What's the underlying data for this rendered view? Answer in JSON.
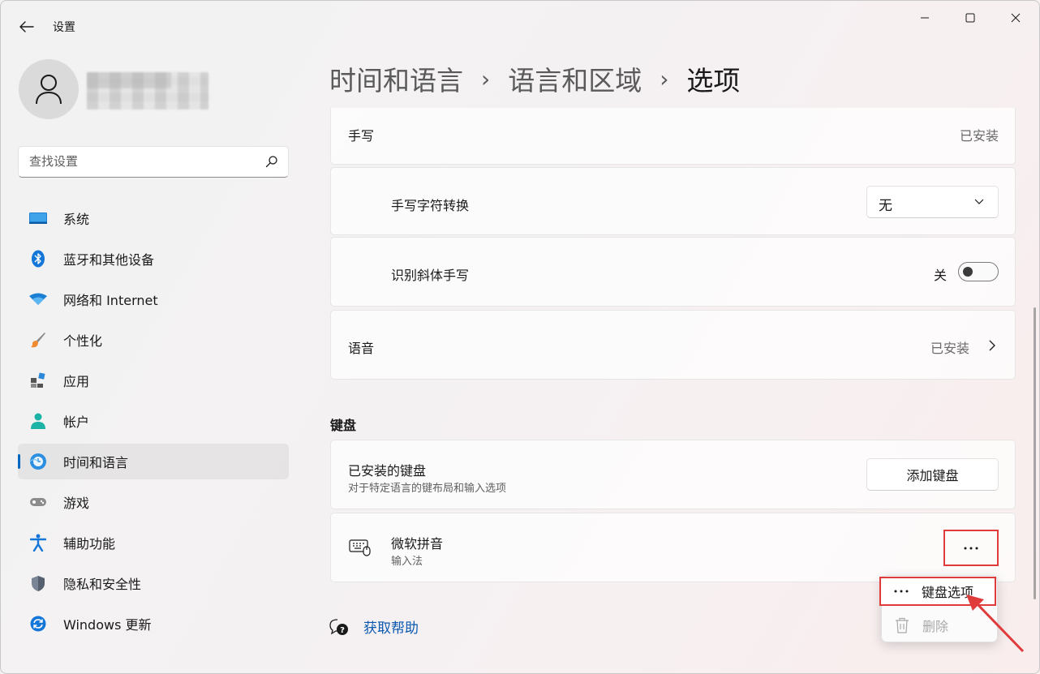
{
  "window": {
    "app_title": "设置",
    "controls": [
      "minimize",
      "maximize",
      "close"
    ]
  },
  "search": {
    "placeholder": "查找设置"
  },
  "sidebar": {
    "items": [
      {
        "label": "系统",
        "icon": "monitor-icon"
      },
      {
        "label": "蓝牙和其他设备",
        "icon": "bluetooth-icon"
      },
      {
        "label": "网络和 Internet",
        "icon": "wifi-icon"
      },
      {
        "label": "个性化",
        "icon": "brush-icon"
      },
      {
        "label": "应用",
        "icon": "apps-icon"
      },
      {
        "label": "帐户",
        "icon": "account-icon"
      },
      {
        "label": "时间和语言",
        "icon": "globe-clock-icon",
        "active": true
      },
      {
        "label": "游戏",
        "icon": "gamepad-icon"
      },
      {
        "label": "辅助功能",
        "icon": "accessibility-icon"
      },
      {
        "label": "隐私和安全性",
        "icon": "shield-icon"
      },
      {
        "label": "Windows 更新",
        "icon": "update-icon"
      }
    ]
  },
  "breadcrumb": {
    "items": [
      "时间和语言",
      "语言和区域",
      "选项"
    ],
    "separator": "›"
  },
  "settings": {
    "handwriting": {
      "label": "手写",
      "status": "已安装"
    },
    "handwriting_conversion": {
      "label": "手写字符转换",
      "value": "无"
    },
    "italic_handwriting": {
      "label": "识别斜体手写",
      "state_text": "关",
      "on": false
    },
    "speech": {
      "label": "语音",
      "status": "已安装"
    }
  },
  "keyboard": {
    "section_title": "键盘",
    "installed": {
      "label": "已安装的键盘",
      "description": "对于特定语言的键布局和输入选项",
      "add_button": "添加键盘"
    },
    "items": [
      {
        "name": "微软拼音",
        "type": "输入法",
        "more_icon": "more-icon"
      }
    ]
  },
  "help": {
    "label": "获取帮助"
  },
  "context_menu": {
    "items": [
      {
        "label": "键盘选项",
        "icon": "more-icon",
        "enabled": true
      },
      {
        "label": "删除",
        "icon": "trash-icon",
        "enabled": false
      }
    ]
  },
  "colors": {
    "accent": "#0067c0",
    "annotation": "#e03b3b",
    "link": "#0a58b0"
  }
}
